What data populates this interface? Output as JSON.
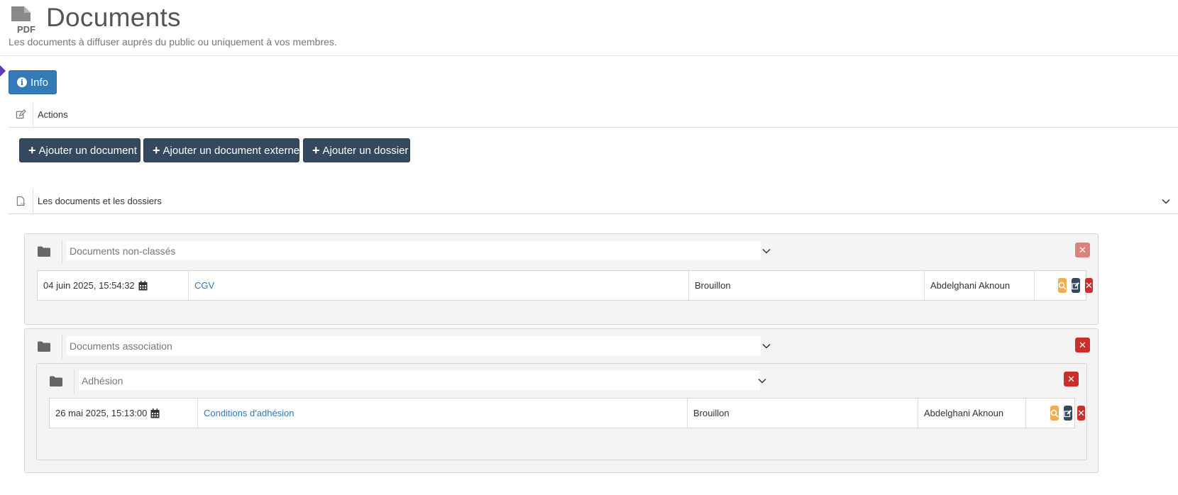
{
  "header": {
    "logo_text": "PDF",
    "title": "Documents",
    "subtitle": "Les documents à diffuser auprès du public ou uniquement à vos membres."
  },
  "info_button": {
    "label": "Info",
    "icon": "info-circle-icon"
  },
  "actions_section": {
    "label": "Actions",
    "icon": "edit-icon",
    "buttons": [
      {
        "label": "Ajouter un document"
      },
      {
        "label": "Ajouter un document externe"
      },
      {
        "label": "Ajouter un dossier"
      }
    ]
  },
  "documents_section": {
    "label": "Les documents et les dossiers",
    "icon": "pdf-file-icon",
    "chevron": "chevron-down-icon"
  },
  "folders": [
    {
      "name": "Documents non-classés",
      "documents": [
        {
          "date": "04 juin 2025, 15:54:32",
          "title": "CGV",
          "status": "Brouillon",
          "author": "Abdelghani Aknoun"
        }
      ]
    },
    {
      "name": "Documents association",
      "subfolders": [
        {
          "name": "Adhésion",
          "documents": [
            {
              "date": "26 mai 2025, 15:13:00",
              "title": "Conditions d'adhésion",
              "status": "Brouillon",
              "author": "Abdelghani Aknoun"
            }
          ]
        }
      ]
    }
  ],
  "colors": {
    "primary": "#337ab7",
    "dark_button": "#34495e",
    "warning": "#f0ad4e",
    "danger": "#c9302c",
    "marker": "#5b3db5"
  }
}
